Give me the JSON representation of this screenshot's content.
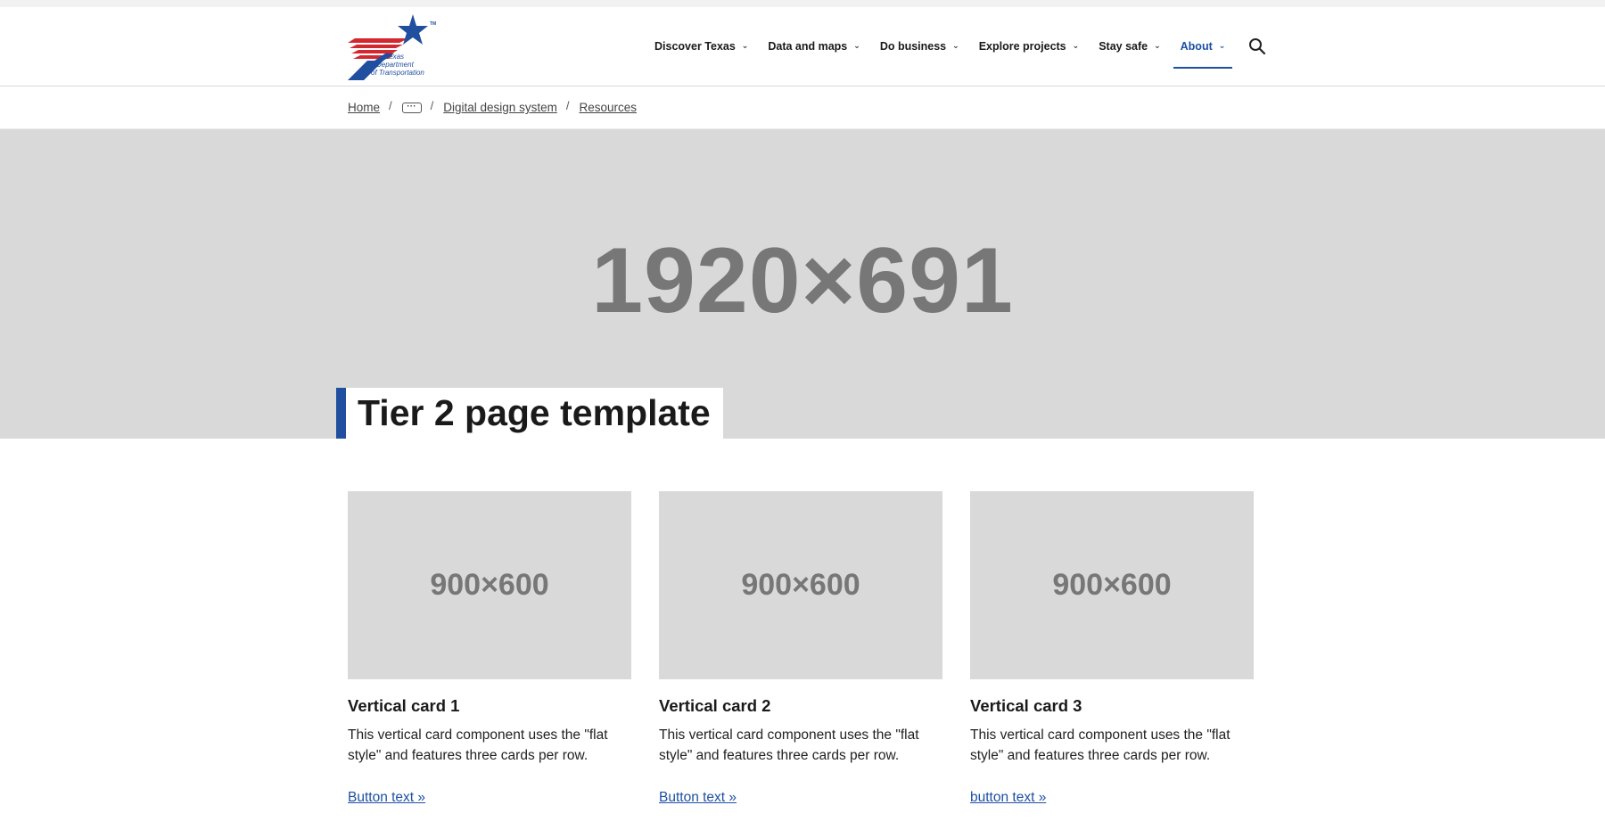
{
  "brand": {
    "logo_lines": [
      "Texas",
      "Department",
      "of Transportation"
    ],
    "trademark": "TM",
    "colors": {
      "blue": "#1f4f9e",
      "red": "#d3282f",
      "accent": "#1d4fa3"
    }
  },
  "nav": {
    "items": [
      {
        "label": "Discover Texas",
        "active": false
      },
      {
        "label": "Data and maps",
        "active": false
      },
      {
        "label": "Do business",
        "active": false
      },
      {
        "label": "Explore projects",
        "active": false
      },
      {
        "label": "Stay safe",
        "active": false
      },
      {
        "label": "About",
        "active": true
      }
    ],
    "search_icon": "search-icon"
  },
  "breadcrumb": {
    "items": [
      "Home",
      "Digital design system",
      "Resources"
    ],
    "ellipsis": "···",
    "separator": "/"
  },
  "hero": {
    "placeholder": "1920×691",
    "title": "Tier 2 page template"
  },
  "cards": [
    {
      "image_placeholder": "900×600",
      "title": "Vertical card 1",
      "description": "This vertical card component uses the \"flat style\" and features three cards per row.",
      "link": "Button text »"
    },
    {
      "image_placeholder": "900×600",
      "title": "Vertical card 2",
      "description": "This vertical card component uses the \"flat style\" and features three cards per row.",
      "link": "Button text »"
    },
    {
      "image_placeholder": "900×600",
      "title": "Vertical card 3",
      "description": "This vertical card component uses the \"flat style\" and features three cards per row.",
      "link": "button text »"
    }
  ]
}
